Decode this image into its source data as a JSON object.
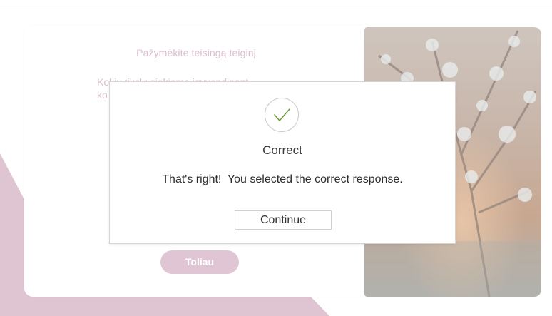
{
  "lesson": {
    "title": "Pažymėkite teisingą teiginį",
    "question_line1": "Kokių tikslų siekiama įgyvendinant",
    "question_line2_partial": "ko",
    "next_button": "Toliau"
  },
  "feedback_dialog": {
    "icon": "checkmark-icon",
    "title": "Correct",
    "message": "That's right!  You selected the correct response.",
    "continue_button": "Continue"
  },
  "colors": {
    "accent_pink": "#d4b0c3",
    "accent_text": "#d1a9bf",
    "check_green": "#6f9a3a"
  }
}
